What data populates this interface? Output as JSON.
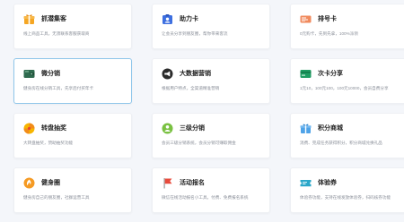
{
  "tools": [
    {
      "icon": "gift-box-icon",
      "title": "抓潜集客",
      "desc": "线上商品工具，无须联系客服获取商"
    },
    {
      "icon": "id-card-icon",
      "title": "助力卡",
      "desc": "让会员分享到朋友圈，帮你带来客流"
    },
    {
      "icon": "ticket-icon",
      "title": "排号卡",
      "desc": "0元购卡，先到先拿，100%派领"
    },
    {
      "icon": "wallet-icon",
      "title": "微分销",
      "desc": "健身房在线分销工具，先享后付买年卡"
    },
    {
      "icon": "megaphone-icon",
      "title": "大数据营销",
      "desc": "根据用户特点，全渠道精准营销"
    },
    {
      "icon": "share-card-icon",
      "title": "次卡分享",
      "desc": "1元10，100元100，100元10000，会员自费分享"
    },
    {
      "icon": "lucky-wheel-icon",
      "title": "转盘抽奖",
      "desc": "大转盘抽奖，赞助抽奖功能"
    },
    {
      "icon": "distribution-icon",
      "title": "三级分销",
      "desc": "会员三级分销系统，会员分销可赚取佣金"
    },
    {
      "icon": "points-mall-icon",
      "title": "积分商城",
      "desc": "消费、完成任务获得积分，积分商城兑换礼品"
    },
    {
      "icon": "fitness-circle-icon",
      "title": "健身圈",
      "desc": "健身房自己的朋友圈，社群运营工具"
    },
    {
      "icon": "flag-icon",
      "title": "活动报名",
      "desc": "微信在线活动报名小工具，付费、免费报名系统"
    },
    {
      "icon": "voucher-icon",
      "title": "体验券",
      "desc": "体验券功能，支持在线发放体验券，扫码核券功能"
    }
  ],
  "colors": {
    "background": "#f4f6fa",
    "selected_border": "#8fc6ea",
    "gift": "#f5a623",
    "idcard": "#3d6fe0",
    "ticket": "#f08a5d",
    "wallet": "#2f6b4f",
    "megaphone": "#2b2b2b",
    "sharecard": "#1f9d63",
    "wheel": "#f7b500",
    "distribution": "#7ac142",
    "points": "#4fa3e8",
    "fitness": "#f59a23",
    "flag": "#e84b3c",
    "voucher": "#2aa7c9"
  }
}
